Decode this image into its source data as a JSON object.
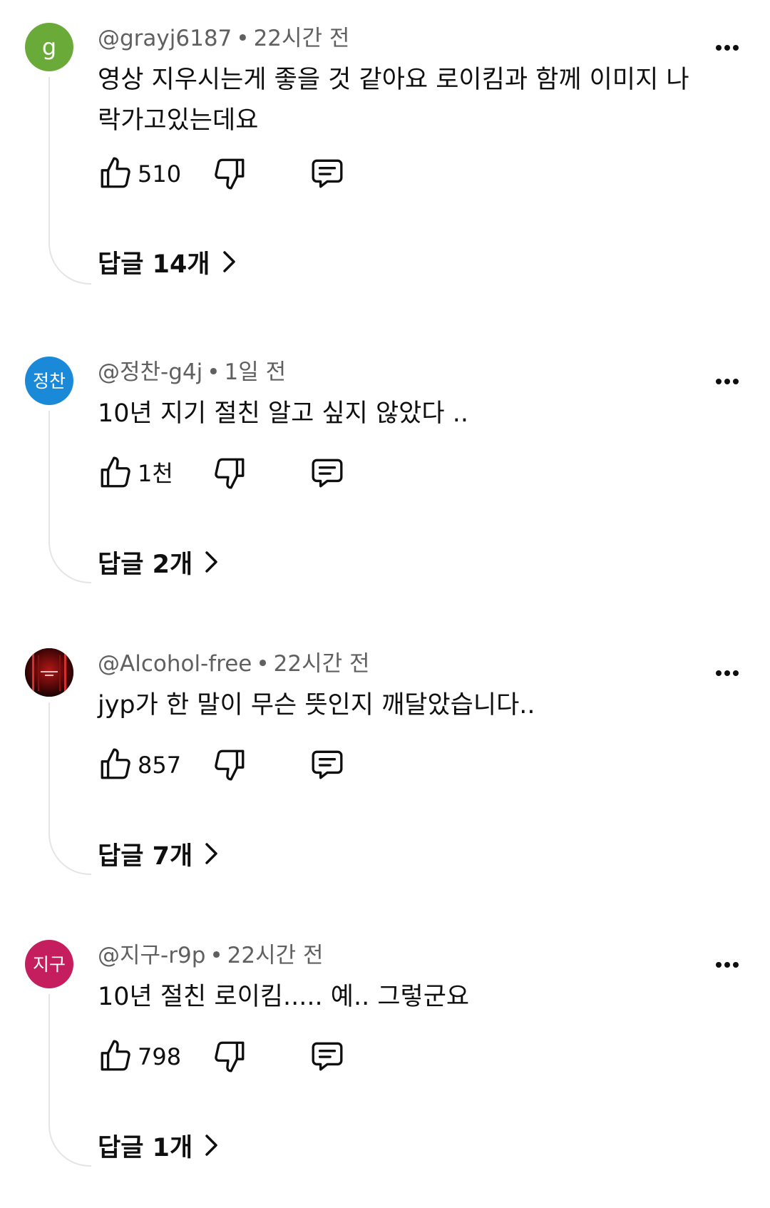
{
  "comments": [
    {
      "avatar": {
        "kind": "letter",
        "text": "g",
        "color": "#6aaa38"
      },
      "author": "@grayj6187",
      "time": "22시간 전",
      "body": "영상 지우시는게 좋을 것 같아요 로이킴과 함께 이미지 나락가고있는데요",
      "likes": "510",
      "replies_label": "답글 14개"
    },
    {
      "avatar": {
        "kind": "text",
        "text": "정찬",
        "color": "#1a8ad8"
      },
      "author": "@정찬-g4j",
      "time": "1일 전",
      "body": "10년 지기 절친 알고 싶지 않았다  ..",
      "likes": "1천",
      "replies_label": "답글 2개"
    },
    {
      "avatar": {
        "kind": "image",
        "color": "#2a0505"
      },
      "author": "@Alcohol-free",
      "time": "22시간 전",
      "body": "jyp가 한 말이 무슨 뜻인지 깨달았습니다..",
      "likes": "857",
      "replies_label": "답글 7개"
    },
    {
      "avatar": {
        "kind": "text",
        "text": "지구",
        "color": "#c41e5e"
      },
      "author": "@지구-r9p",
      "time": "22시간 전",
      "body": "10년 절친 로이킴..... 예.. 그렇군요",
      "likes": "798",
      "replies_label": "답글 1개"
    }
  ],
  "separator": "•",
  "icons": {
    "more": "more-horizontal-icon",
    "like": "thumbs-up-icon",
    "dislike": "thumbs-down-icon",
    "reply": "comment-icon",
    "chevron": "chevron-right-icon"
  }
}
